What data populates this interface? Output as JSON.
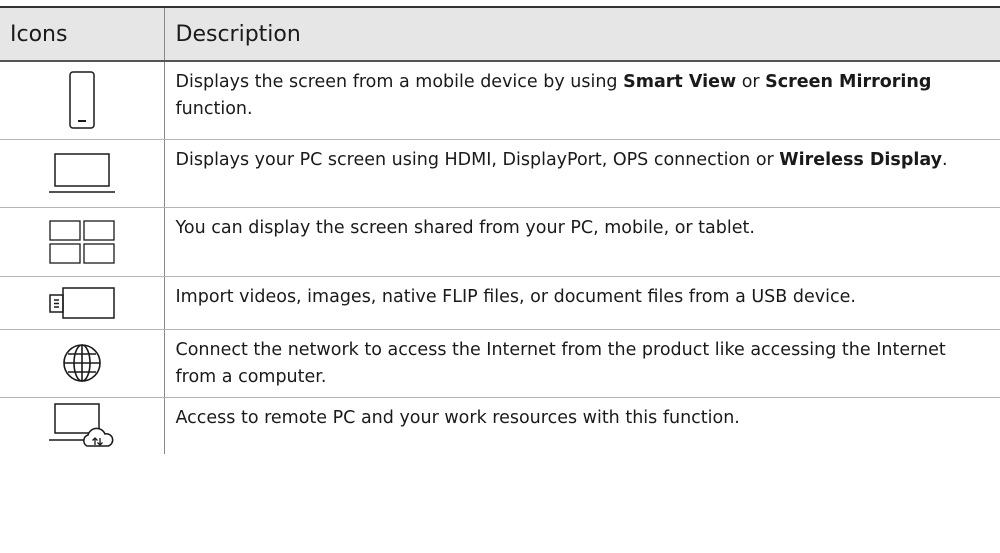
{
  "header": {
    "col_icons": "Icons",
    "col_description": "Description"
  },
  "rows": [
    {
      "icon": "mobile-device-icon",
      "parts": [
        "Displays the screen from a mobile device by using ",
        "Smart View",
        " or ",
        "Screen Mirroring",
        " function."
      ]
    },
    {
      "icon": "laptop-pc-icon",
      "parts": [
        "Displays your PC screen using HDMI, DisplayPort, OPS connection or ",
        "Wireless Display",
        "."
      ]
    },
    {
      "icon": "screen-share-grid-icon",
      "text": "You can display the screen shared from your PC, mobile, or tablet."
    },
    {
      "icon": "usb-device-icon",
      "text": "Import videos, images, native FLIP files, or document files from a USB device."
    },
    {
      "icon": "globe-internet-icon",
      "text": "Connect the network to access the Internet from the product like accessing the Internet from a computer."
    },
    {
      "icon": "remote-pc-icon",
      "text": "Access to remote PC and your work resources with this function."
    }
  ]
}
